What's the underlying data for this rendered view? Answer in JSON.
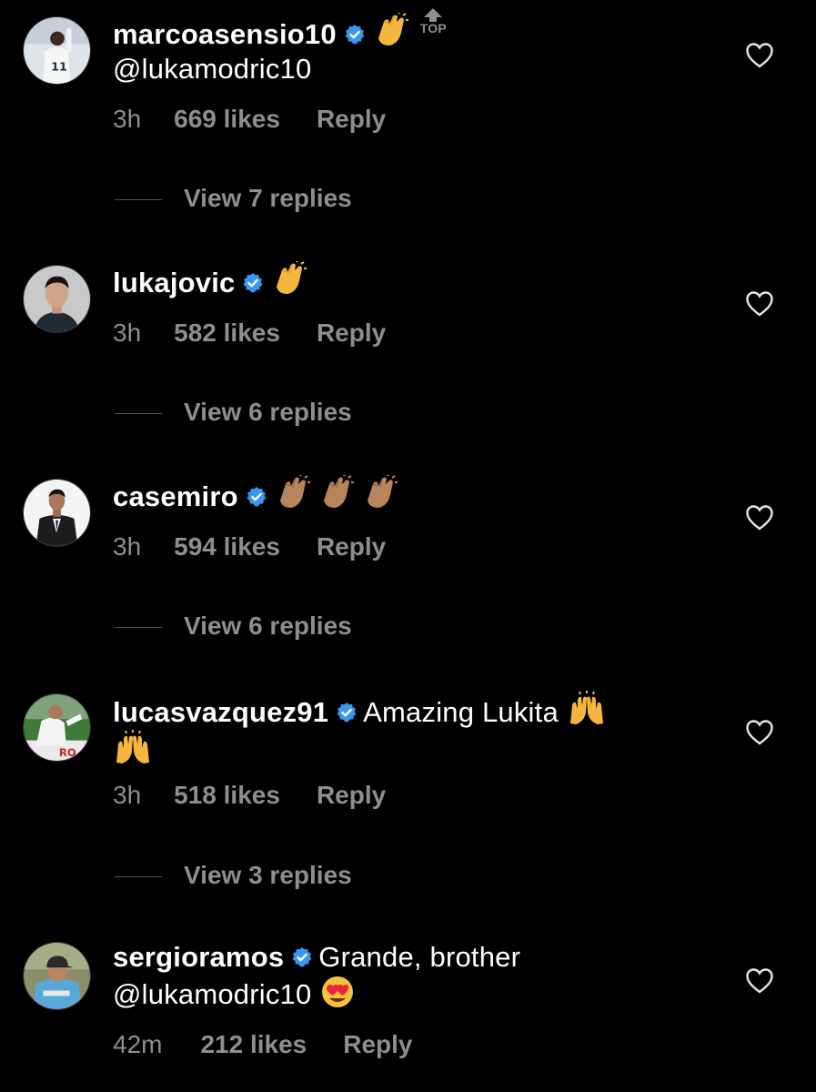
{
  "comments": [
    {
      "username": "marcoasensio10",
      "text_before": "",
      "text": "",
      "mention": "@lukamodric10",
      "emoji": "clapping-hands",
      "time": "3h",
      "likes": "669 likes",
      "reply": "Reply",
      "view_replies": "View 7 replies",
      "top_label": "TOP",
      "avatar_icon": "player-jersey-11-avatar"
    },
    {
      "username": "lukajovic",
      "text": "",
      "time": "3h",
      "likes": "582 likes",
      "reply": "Reply",
      "view_replies": "View 6 replies",
      "avatar_icon": "man-portrait-avatar"
    },
    {
      "username": "casemiro",
      "text": "",
      "time": "3h",
      "likes": "594 likes",
      "reply": "Reply",
      "view_replies": "View 6 replies",
      "avatar_icon": "man-suit-avatar"
    },
    {
      "username": "lucasvazquez91",
      "text": "Amazing Lukita",
      "time": "3h",
      "likes": "518 likes",
      "reply": "Reply",
      "view_replies": "View 3 replies",
      "avatar_icon": "football-match-avatar"
    },
    {
      "username": "sergioramos",
      "text": "Grande, brother",
      "mention": "@lukamodric10",
      "time": "42m",
      "likes": "212 likes",
      "reply": "Reply",
      "avatar_icon": "man-cap-avatar"
    }
  ],
  "colors": {
    "background": "#000000",
    "text": "#ffffff",
    "secondary": "#8e8e8e",
    "verified": "#3897f0"
  }
}
